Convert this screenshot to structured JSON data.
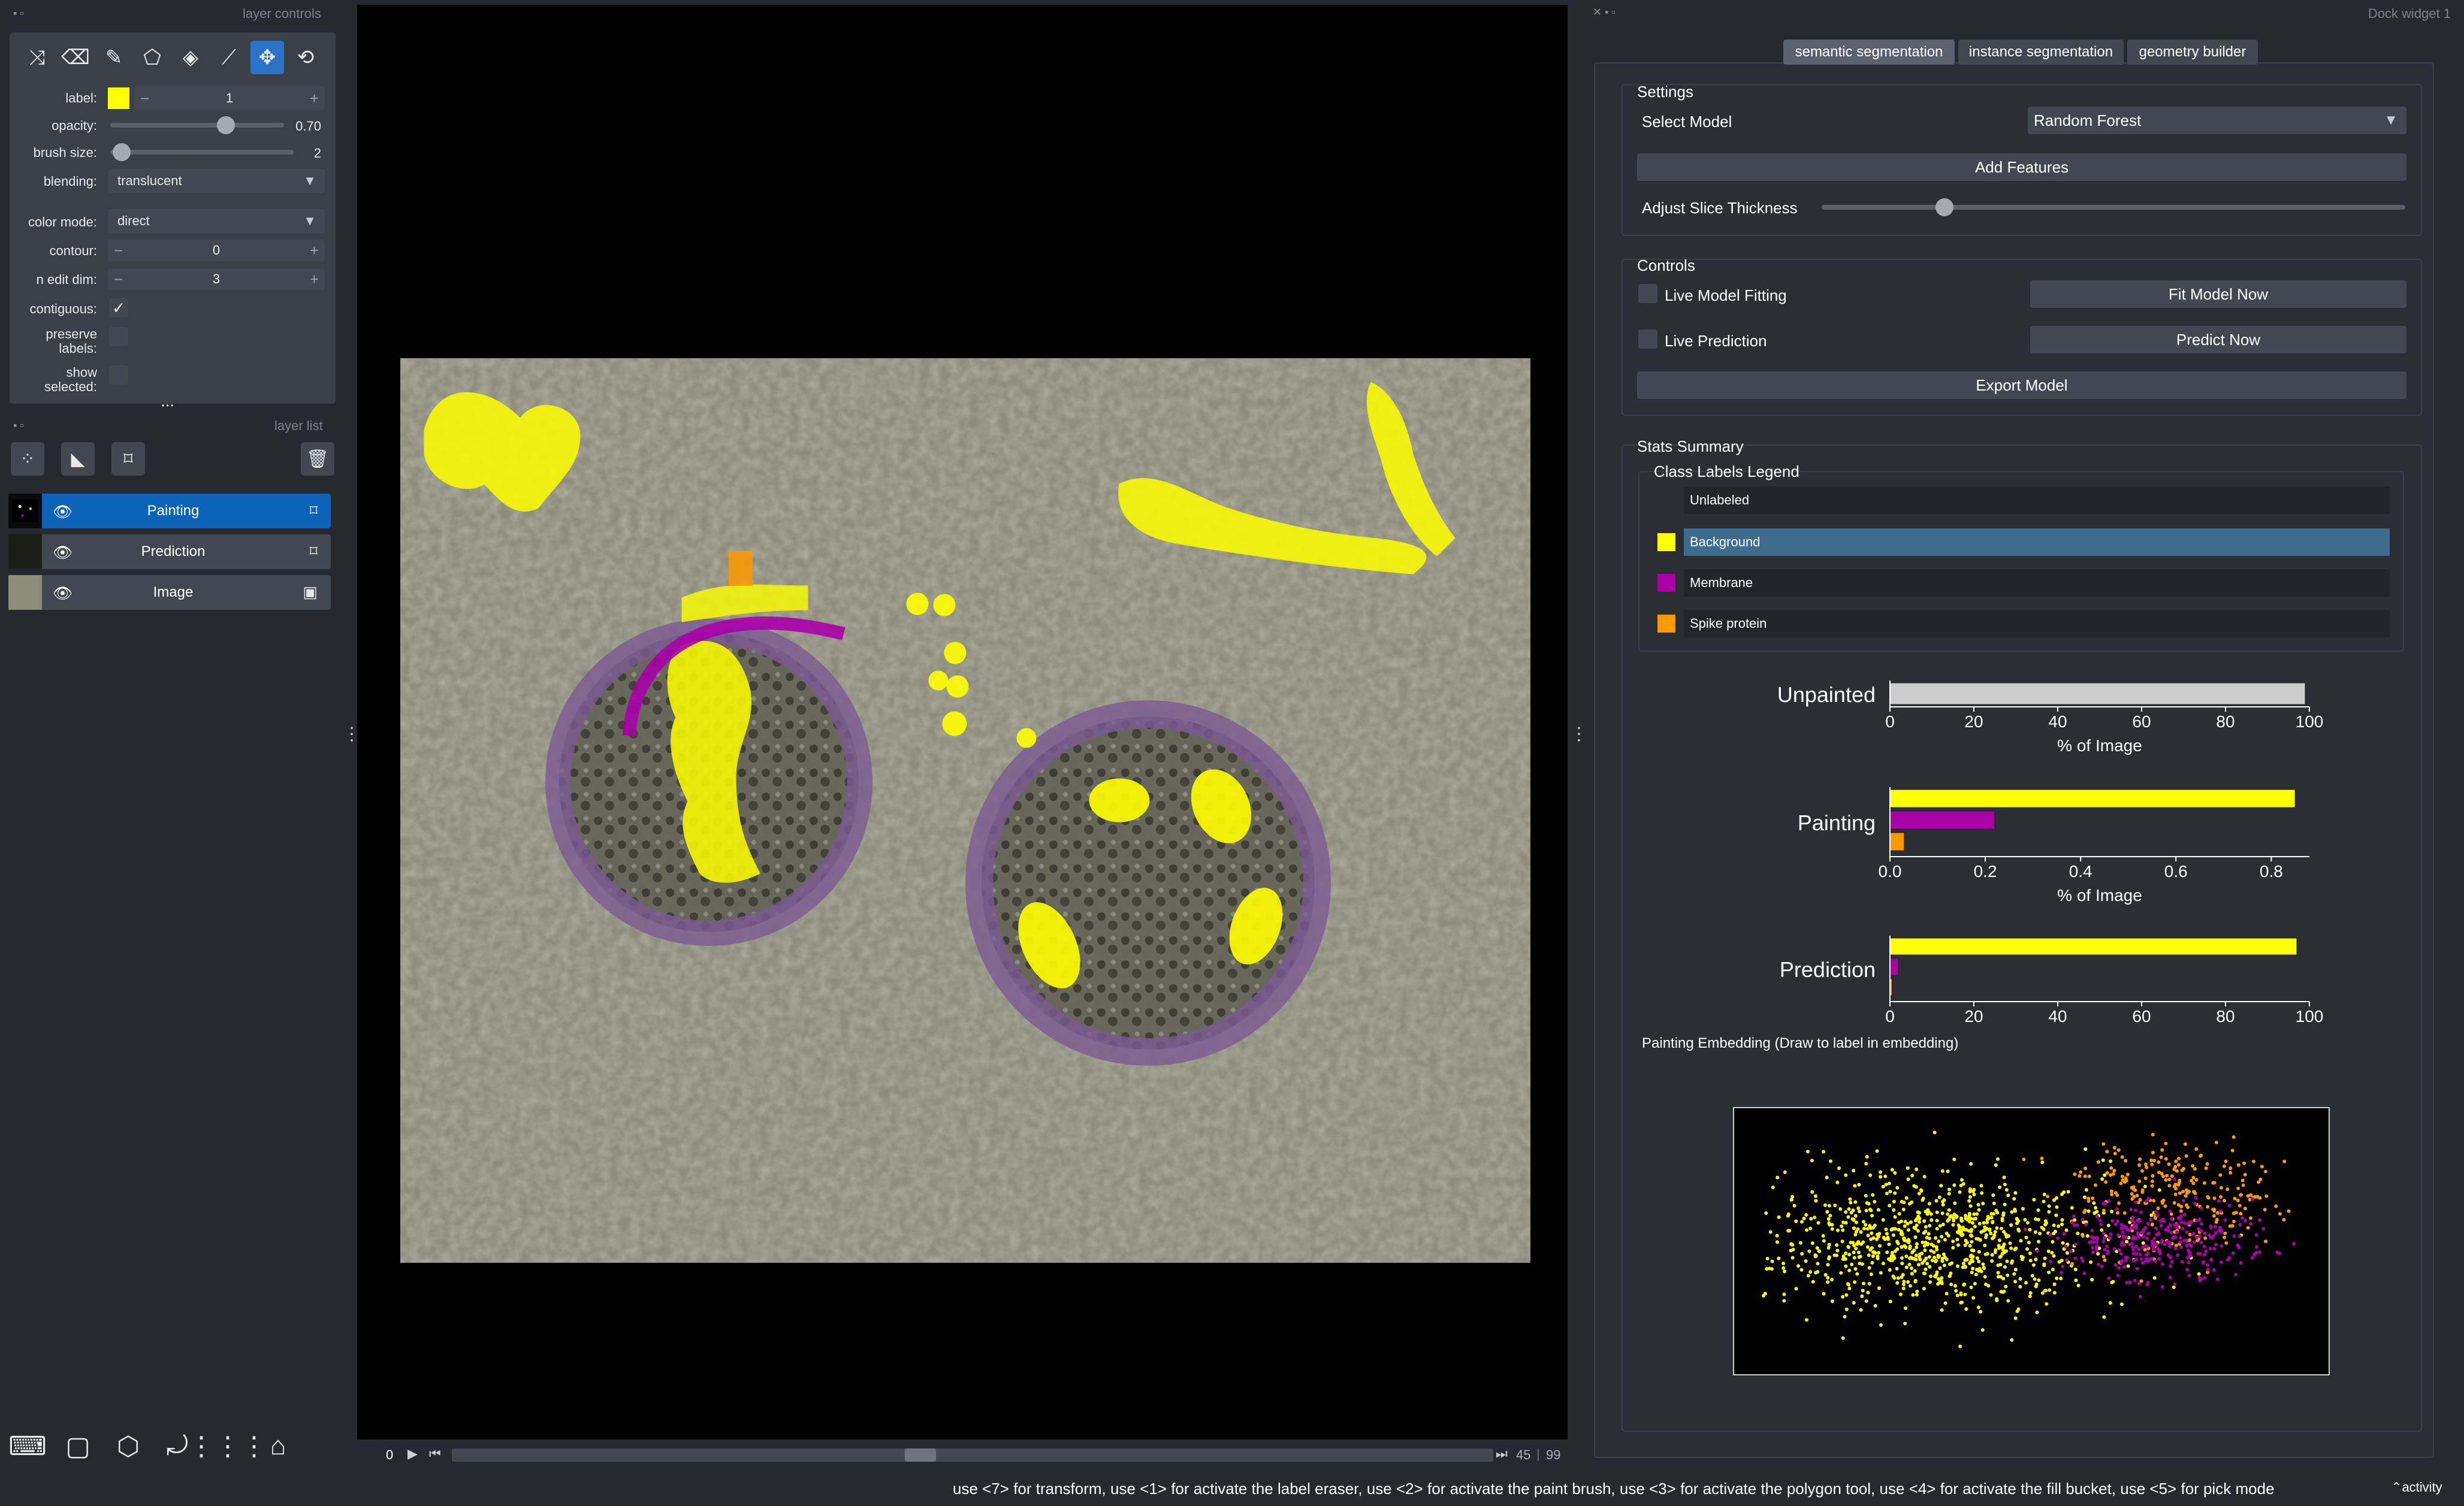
{
  "panels": {
    "layer_controls_title": "layer controls",
    "layer_list_title": "layer list",
    "dock_title": "Dock widget 1"
  },
  "layer_controls": {
    "tools": [
      "shuffle-icon",
      "eraser-icon",
      "paint-brush-icon",
      "polygon-icon",
      "fill-bucket-icon",
      "color-picker-icon",
      "pan-zoom-icon",
      "transform-icon"
    ],
    "active_tool": "pan-zoom-icon",
    "label_label": "label:",
    "label_value": "1",
    "label_color": "#ffff00",
    "minus": "−",
    "plus": "+",
    "opacity_label": "opacity:",
    "opacity_value": "0.70",
    "brush_size_label": "brush size:",
    "brush_size_value": "2",
    "blending_label": "blending:",
    "blending_value": "translucent",
    "color_mode_label": "color mode:",
    "color_mode_value": "direct",
    "contour_label": "contour:",
    "contour_value": "0",
    "n_edit_dim_label": "n edit dim:",
    "n_edit_dim_value": "3",
    "contiguous_label": "contiguous:",
    "contiguous_checked": true,
    "contiguous_mark": "✓",
    "preserve_labels_label": "preserve\nlabels:",
    "show_selected_label": "show\nselected:",
    "more_dots": "• • •"
  },
  "layer_list": {
    "buttons": [
      "points-icon",
      "shapes-icon",
      "labels-icon",
      "delete-icon"
    ],
    "layers": [
      {
        "name": "Painting",
        "selected": true,
        "type_icon": "labels-icon"
      },
      {
        "name": "Prediction",
        "selected": false,
        "type_icon": "labels-icon"
      },
      {
        "name": "Image",
        "selected": false,
        "type_icon": "image-icon"
      }
    ]
  },
  "bottom_buttons": [
    "console-icon",
    "ndisplay-icon",
    "roll-dims-icon",
    "transpose-icon",
    "grid-icon",
    "home-icon"
  ],
  "slider": {
    "axis": "0",
    "current": "45",
    "total": "99",
    "position_fraction": 0.45
  },
  "dock": {
    "tabs": [
      "semantic segmentation",
      "instance segmentation",
      "geometry builder"
    ],
    "selected_tab": "semantic segmentation",
    "settings": {
      "title": "Settings",
      "select_model_label": "Select Model",
      "model_value": "Random Forest",
      "add_features_label": "Add Features",
      "slice_thickness_label": "Adjust Slice Thickness",
      "slice_thickness_fraction": 0.21
    },
    "controls": {
      "title": "Controls",
      "live_fitting_label": "Live Model Fitting",
      "fit_now_label": "Fit Model Now",
      "live_prediction_label": "Live Prediction",
      "predict_now_label": "Predict Now",
      "export_label": "Export Model"
    },
    "stats": {
      "title": "Stats Summary",
      "legend_title": "Class Labels Legend",
      "classes": [
        {
          "name": "Unlabeled",
          "color": null,
          "selected": false
        },
        {
          "name": "Background",
          "color": "#ffff00",
          "selected": true
        },
        {
          "name": "Membrane",
          "color": "#aa00aa",
          "selected": false
        },
        {
          "name": "Spike protein",
          "color": "#ff9900",
          "selected": false
        }
      ],
      "embedding_caption": "Painting Embedding (Draw to label in embedding)"
    }
  },
  "chart_data": [
    {
      "type": "bar",
      "orientation": "horizontal",
      "title": "Unpainted",
      "xlabel": "% of Image",
      "xlim": [
        0,
        100
      ],
      "ticks": [
        "0",
        "20",
        "40",
        "60",
        "80",
        "100"
      ],
      "series": [
        {
          "values": [
            99.0
          ],
          "color": "#cccccc"
        }
      ]
    },
    {
      "type": "bar",
      "orientation": "horizontal",
      "title": "Painting",
      "xlabel": "% of Image",
      "xlim": [
        0,
        0.88
      ],
      "ticks": [
        "0.0",
        "0.2",
        "0.4",
        "0.6",
        "0.8"
      ],
      "series": [
        {
          "values": [
            0.85,
            0.22,
            0.03
          ],
          "colors": [
            "#ffff00",
            "#aa00aa",
            "#ff9900"
          ]
        }
      ]
    },
    {
      "type": "bar",
      "orientation": "horizontal",
      "title": "Prediction",
      "xlim": [
        0,
        100
      ],
      "ticks": [
        "0",
        "20",
        "40",
        "60",
        "80",
        "100"
      ],
      "series": [
        {
          "values": [
            97.0,
            2.0,
            0.5
          ],
          "colors": [
            "#ffff00",
            "#aa00aa",
            "#ff9900"
          ]
        }
      ]
    },
    {
      "type": "scatter",
      "title": "",
      "clusters": [
        {
          "label": "Background",
          "color": "#ffff00",
          "center": [
            0.33,
            0.5
          ],
          "spread": [
            0.17,
            0.14
          ],
          "n": 900
        },
        {
          "label": "Spike protein",
          "color": "#ff9900",
          "center": [
            0.75,
            0.3
          ],
          "spread": [
            0.09,
            0.12
          ],
          "n": 260
        },
        {
          "label": "Membrane",
          "color": "#aa00aa",
          "center": [
            0.72,
            0.5
          ],
          "spread": [
            0.09,
            0.08
          ],
          "n": 320
        }
      ]
    }
  ],
  "status_hint": "use <7> for transform, use <1> for activate the label eraser, use <2> for activate the paint brush, use <3> for activate the polygon tool, use <4> for activate the fill bucket, use <5> for pick mode",
  "activity_label": "activity"
}
